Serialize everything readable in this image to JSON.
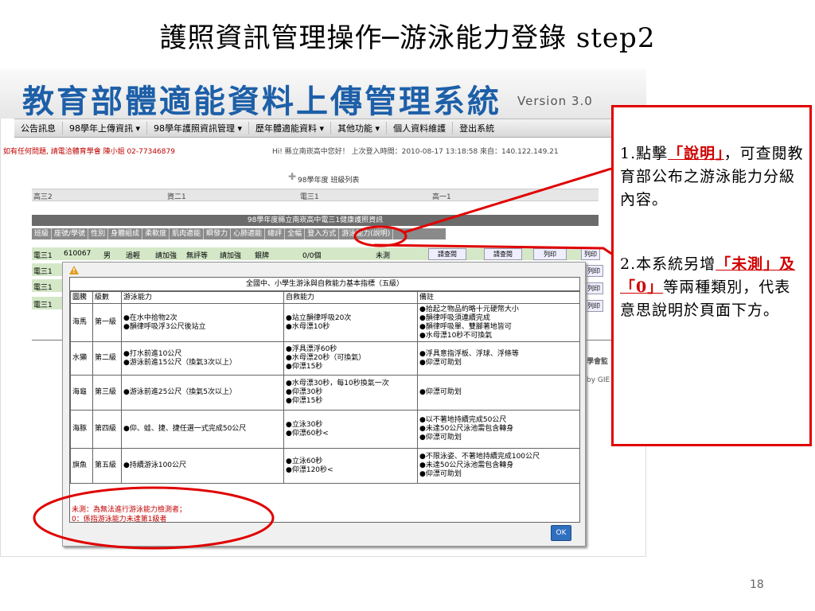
{
  "slide": {
    "title": "護照資訊管理操作─游泳能力登錄 step2",
    "page_number": "18"
  },
  "app": {
    "title": "教育部體適能資料上傳管理系統",
    "version": "Version 3.0",
    "nav": [
      "公告訊息",
      "98學年上傳資訊 ▾",
      "98學年護照資訊管理 ▾",
      "歷年體適能資料 ▾",
      "其他功能 ▾",
      "個人資料維護",
      "登出系統"
    ],
    "contact": "如有任何問題, 請電洽體育學會 陳小姐 02-77346879",
    "welcome": "Hi! 縣立南崁高中您好！ 上次登入時間：2010-08-17 13:18:58 來自：140.122.149.21",
    "class_list_title": "98學年度 班級列表",
    "gray_row": [
      "高三2",
      "資二1",
      "電三1",
      "高一1"
    ],
    "dark_bar": "98學年度縣立南崁高中電三1健康護照資訊",
    "columns": [
      "班級",
      "座號/學號",
      "性別",
      "身體組成",
      "柔軟度",
      "肌肉適能",
      "瞬發力",
      "心肺適能",
      "總評",
      "全幅",
      "登入方式",
      "游泳能力(說明)"
    ],
    "row1": {
      "class": "電三1",
      "id": "610067",
      "sex": "男",
      "body": "過輕",
      "flex": "請加強",
      "muscle": "無評等",
      "power": "請加強",
      "cardio": "銀牌",
      "count": "0/0個",
      "swim": "未測"
    },
    "row_classes": [
      "電三1",
      "電三1",
      "電三1",
      "電三1"
    ],
    "row_buttons": [
      "請查閱",
      "請查閱",
      "列印",
      "列印"
    ],
    "side_text": [
      "學會監",
      "by GIE"
    ]
  },
  "dialog": {
    "table_title": "全國中、小學生游泳與自救能力基本指標（五級）",
    "headers": [
      "圖騰",
      "級數",
      "游泳能力",
      "自救能力",
      "備註"
    ],
    "rows": [
      {
        "totem": "海馬",
        "level": "第一級",
        "swim": [
          "●在水中拾物2次",
          "●韻律呼吸浮3公尺後站立"
        ],
        "rescue": [
          "●站立韻律呼吸20次",
          "●水母漂10秒"
        ],
        "note": [
          "●拾起之物品約略十元硬幣大小",
          "●韻律呼吸須連續完成",
          "●韻律呼吸單、雙腳著地皆可",
          "●水母漂10秒不可換氣"
        ]
      },
      {
        "totem": "水獺",
        "level": "第二級",
        "swim": [
          "●打水前進10公尺",
          "●游泳前進15公尺（換氣3次以上）"
        ],
        "rescue": [
          "●浮具漂浮60秒",
          "●水母漂20秒（可換氣）",
          "●仰漂15秒"
        ],
        "note": [
          "●浮具意指浮板、浮球、浮條等",
          "●仰漂可助划"
        ]
      },
      {
        "totem": "海龜",
        "level": "第三級",
        "swim": [
          "●游泳前進25公尺（換氣5次以上）"
        ],
        "rescue": [
          "●水母漂30秒，每10秒換氣一次",
          "●仰漂30秒",
          "●仰漂15秒"
        ],
        "note": [
          "●仰漂可助划"
        ]
      },
      {
        "totem": "海豚",
        "level": "第四級",
        "swim": [
          "●仰、蛙、捷、捷任選一式完成50公尺"
        ],
        "rescue": [
          "●立泳30秒",
          "●仰漂60秒<"
        ],
        "note": [
          "●以不著地持續完成50公尺",
          "●未達50公尺泳池需包含轉身",
          "●仰漂可助划"
        ]
      },
      {
        "totem": "旗魚",
        "level": "第五級",
        "swim": [
          "●持續游泳100公尺"
        ],
        "rescue": [
          "●立泳60秒",
          "●仰漂120秒<"
        ],
        "note": [
          "●不限泳姿、不著地持續完成100公尺",
          "●未達50公尺泳池需包含轉身",
          "●仰漂可助划"
        ]
      }
    ],
    "notes": [
      "未測：為無法進行游泳能力檢測者；",
      "0：係指游泳能力未達第1級者"
    ],
    "ok": "OK"
  },
  "callout": {
    "item1_prefix": "1.點擊",
    "item1_highlight": "「說明」",
    "item1_suffix": "，可查閱教育部公布之游泳能力分級內容。",
    "item2_prefix": "2.本系統另增",
    "item2_highlight": "「未測」及「0」",
    "item2_suffix": "等兩種類別，代表意思說明於頁面下方。"
  },
  "colors": {
    "accent_red": "#e00000",
    "title_blue": "#1d5fa8",
    "row_green": "#d4e8c8"
  }
}
